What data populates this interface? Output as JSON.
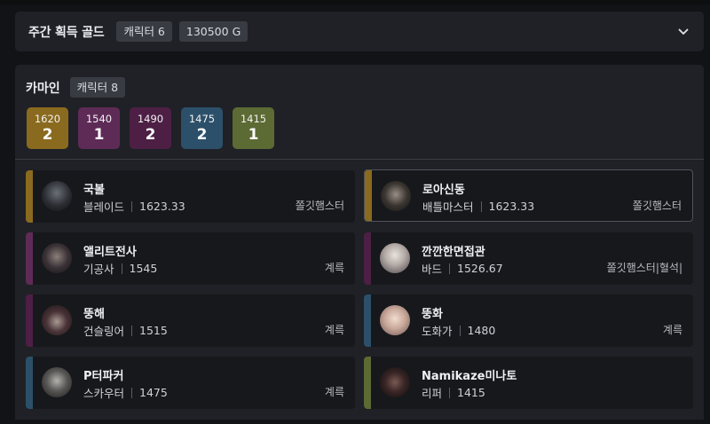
{
  "gold_summary": {
    "title": "주간 획득 골드",
    "character_chip": "캐릭터 6",
    "gold_chip": "130500 G",
    "toggle_icon": "chevron-down-icon"
  },
  "roster": {
    "server_name": "카마인",
    "character_count_chip": "캐릭터 8",
    "levels": [
      {
        "level": "1620",
        "count": "2",
        "color": "#8a6a1e"
      },
      {
        "level": "1540",
        "count": "1",
        "color": "#5e2b57"
      },
      {
        "level": "1490",
        "count": "2",
        "color": "#4d1f45"
      },
      {
        "level": "1475",
        "count": "2",
        "color": "#2c506a"
      },
      {
        "level": "1415",
        "count": "1",
        "color": "#5c6a34"
      }
    ],
    "characters": [
      {
        "name": "국볼",
        "class": "블레이드",
        "item_level": "1623.33",
        "guild": "쫄깃햄스터",
        "color": "#8a6a1e",
        "selected": false
      },
      {
        "name": "로아신동",
        "class": "배틀마스터",
        "item_level": "1623.33",
        "guild": "쫄깃햄스터",
        "color": "#8a6a1e",
        "selected": true
      },
      {
        "name": "앨리트전사",
        "class": "기공사",
        "item_level": "1545",
        "guild": "계륵",
        "color": "#5e2b57",
        "selected": false
      },
      {
        "name": "깐깐한면접관",
        "class": "바드",
        "item_level": "1526.67",
        "guild": "쫄깃햄스터|혈석|",
        "color": "#4d1f45",
        "selected": false
      },
      {
        "name": "뚱해",
        "class": "건슬링어",
        "item_level": "1515",
        "guild": "계륵",
        "color": "#4d1f45",
        "selected": false
      },
      {
        "name": "뚱화",
        "class": "도화가",
        "item_level": "1480",
        "guild": "계륵",
        "color": "#2c506a",
        "selected": false
      },
      {
        "name": "P터파커",
        "class": "스카우터",
        "item_level": "1475",
        "guild": "계륵",
        "color": "#2c506a",
        "selected": false
      },
      {
        "name": "Namikaze미나토",
        "class": "리퍼",
        "item_level": "1415",
        "guild": "",
        "color": "#5c6a34",
        "selected": false
      }
    ]
  }
}
